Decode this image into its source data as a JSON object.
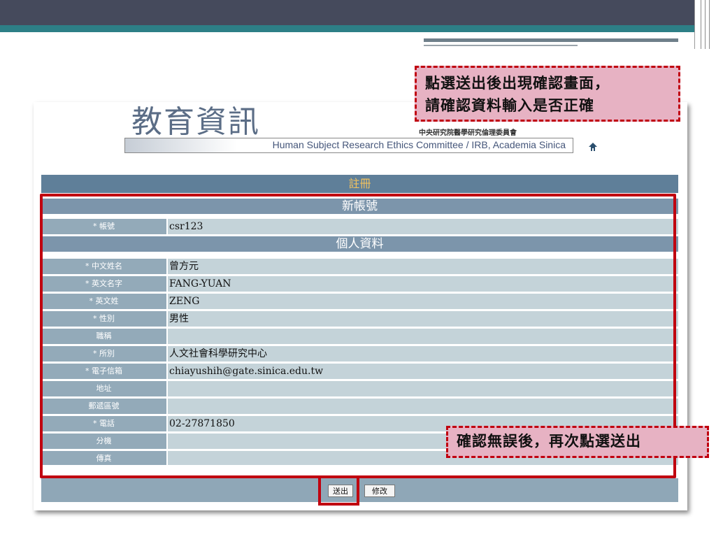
{
  "logo": {
    "title": "教育資訊",
    "org_name": "中央研究院醫學研究倫理委員會",
    "subtitle": "Human Subject Research Ethics Committee / IRB, Academia Sinica",
    "home_icon": "home-icon"
  },
  "form": {
    "header": "註冊",
    "section_account": "新帳號",
    "account": {
      "label": "* 帳號",
      "value": "csr123"
    },
    "section_personal": "個人資料",
    "fields": [
      {
        "label": "* 中文姓名",
        "value": "曾方元"
      },
      {
        "label": "* 英文名字",
        "value": "FANG-YUAN"
      },
      {
        "label": "* 英文姓",
        "value": "ZENG"
      },
      {
        "label": "* 性別",
        "value": "男性"
      },
      {
        "label": "職稱",
        "value": ""
      },
      {
        "label": "* 所別",
        "value": "人文社會科學研究中心"
      },
      {
        "label": "* 電子信箱",
        "value": "chiayushih@gate.sinica.edu.tw"
      },
      {
        "label": "地址",
        "value": ""
      },
      {
        "label": "郵遞區號",
        "value": ""
      },
      {
        "label": "* 電話",
        "value": "02-27871850"
      },
      {
        "label": "分機",
        "value": ""
      },
      {
        "label": "傳真",
        "value": ""
      }
    ],
    "buttons": {
      "send": "送出",
      "edit": "修改"
    }
  },
  "annotations": {
    "top_note_line1": "點選送出後出現確認畫面，",
    "top_note_line2": "請確認資料輸入是否正確",
    "bottom_note": "確認無誤後，再次點選送出"
  },
  "colors": {
    "highlight": "#c0000f",
    "note_fill": "#e7b2c3",
    "header_bar": "#5f7f99",
    "header_text": "#f2c25f"
  }
}
